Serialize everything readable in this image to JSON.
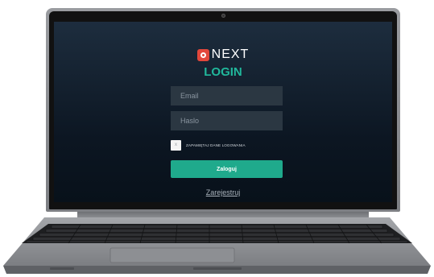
{
  "login": {
    "brand": "NEXT",
    "title": "LOGIN",
    "email_placeholder": "Email",
    "password_placeholder": "Haslo",
    "remember_label": "ZAPAMIĘTAJ DANE LOGOWANIA",
    "submit_label": "Zaloguj",
    "register_link": "Zarejestruj"
  },
  "colors": {
    "accent": "#21b89c",
    "button": "#1faa8c",
    "brand_mark": "#e2473b",
    "screen_bg": "#0c1622"
  },
  "icons": {
    "brand_logo": "next-logo-icon",
    "checkbox_mark": "x"
  }
}
